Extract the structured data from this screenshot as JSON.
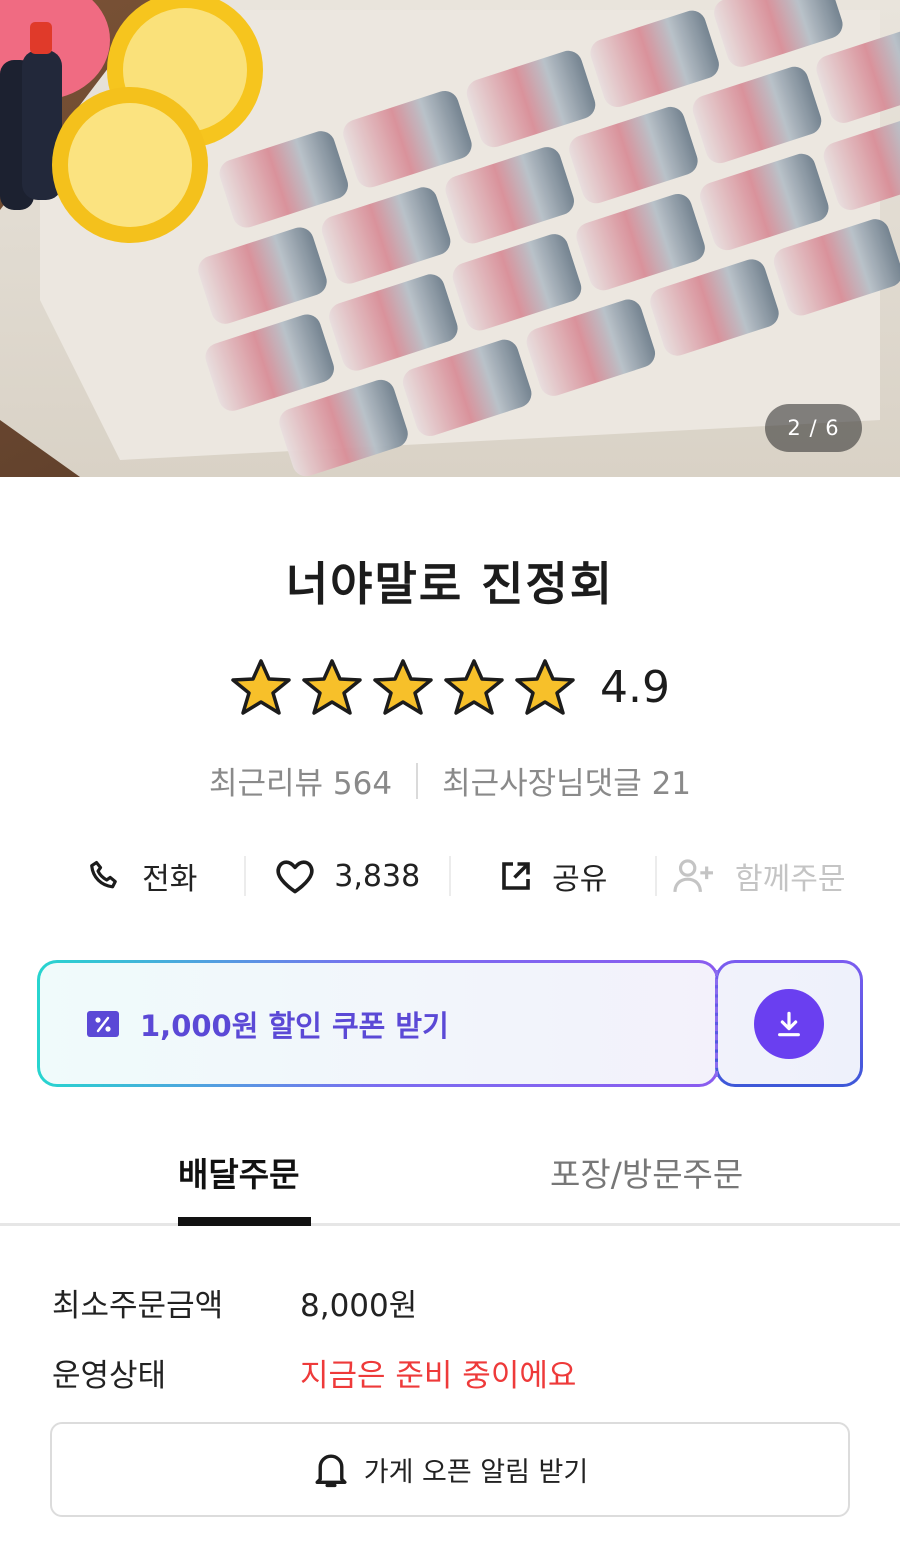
{
  "hero": {
    "page_indicator": "2 / 6"
  },
  "store": {
    "name": "너야말로 진정회",
    "rating": "4.9",
    "star_count": 5,
    "recent_reviews_label": "최근리뷰 564",
    "owner_comments_label": "최근사장님댓글 21"
  },
  "actions": {
    "call_label": "전화",
    "like_count": "3,838",
    "share_label": "공유",
    "group_order_label": "함께주문"
  },
  "coupon": {
    "label": "1,000원 할인 쿠폰 받기"
  },
  "tabs": [
    {
      "label": "배달주문",
      "active": true
    },
    {
      "label": "포장/방문주문",
      "active": false
    }
  ],
  "info": {
    "min_order_label": "최소주문금액",
    "min_order_value": "8,000원",
    "status_label": "운영상태",
    "status_value": "지금은 준비 중이에요"
  },
  "notify_button": {
    "label": "가게 오픈 알림 받기"
  },
  "colors": {
    "accent": "#6a3ff0",
    "status_red": "#ee3a3a",
    "star": "#f7c02a"
  }
}
